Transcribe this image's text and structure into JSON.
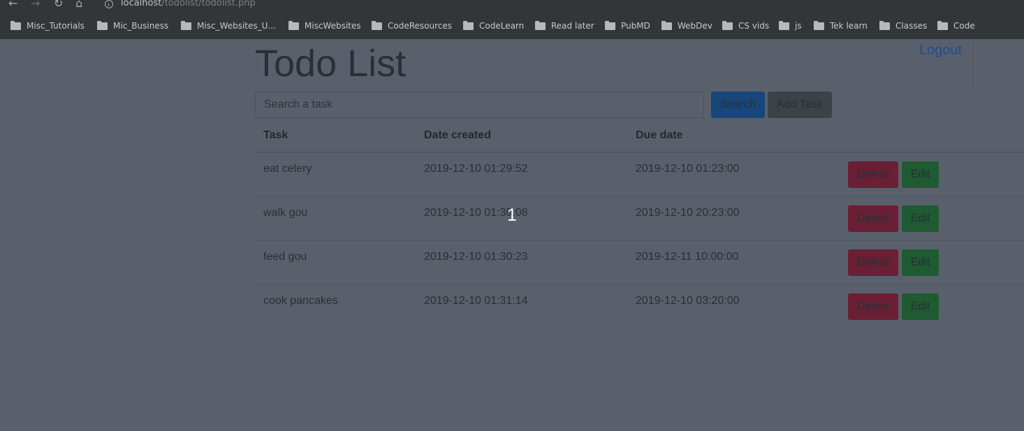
{
  "browser": {
    "url_host": "localhost",
    "url_path": "/todolist/todolist.php",
    "bookmarks": [
      {
        "label": "Misc_Tutorials"
      },
      {
        "label": "Mic_Business"
      },
      {
        "label": "Misc_Websites_U..."
      },
      {
        "label": "MiscWebsites"
      },
      {
        "label": "CodeResources"
      },
      {
        "label": "CodeLearn"
      },
      {
        "label": "Read later"
      },
      {
        "label": "PubMD"
      },
      {
        "label": "WebDev"
      },
      {
        "label": "CS vids"
      },
      {
        "label": "js"
      },
      {
        "label": "Tek learn"
      },
      {
        "label": "Classes"
      },
      {
        "label": "Code"
      }
    ]
  },
  "page": {
    "title": "Todo List",
    "logout_label": "Logout"
  },
  "toolbar": {
    "search_placeholder": "Search a task",
    "search_label": "Search",
    "add_label": "Add Task"
  },
  "table": {
    "headers": {
      "task": "Task",
      "created": "Date created",
      "due": "Due date"
    },
    "rows": [
      {
        "task": "eat celery",
        "created": "2019-12-10 01:29:52",
        "due": "2019-12-10 01:23:00",
        "delete_label": "Delete",
        "edit_label": "Edit"
      },
      {
        "task": "walk gou",
        "created": "2019-12-10 01:30:08",
        "due": "2019-12-10 20:23:00",
        "delete_label": "Delete",
        "edit_label": "Edit"
      },
      {
        "task": "feed gou",
        "created": "2019-12-10 01:30:23",
        "due": "2019-12-11 10:00:00",
        "delete_label": "Delete",
        "edit_label": "Edit"
      },
      {
        "task": "cook pancakes",
        "created": "2019-12-10 01:31:14",
        "due": "2019-12-10 03:20:00",
        "delete_label": "Delete",
        "edit_label": "Edit"
      }
    ]
  },
  "overlay": {
    "counter": "1"
  },
  "colors": {
    "overlay_dim": "#5a606b",
    "primary_button": "#17467a",
    "secondary_button": "#3d4148",
    "delete_button": "#6a1f35",
    "edit_button": "#1f5a32",
    "link": "#1b4f8f"
  }
}
